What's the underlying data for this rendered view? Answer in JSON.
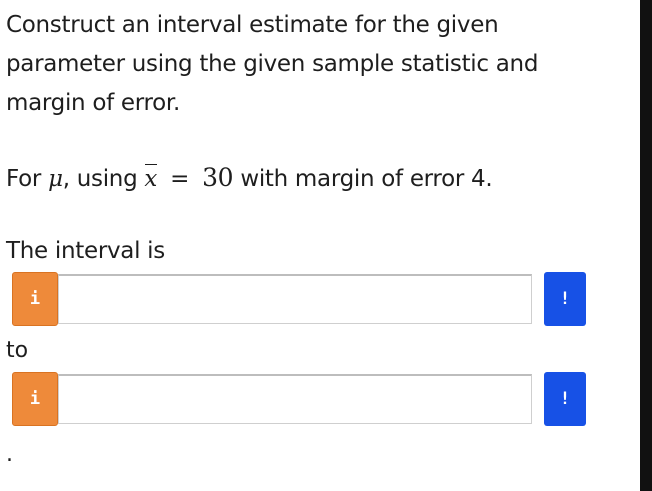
{
  "question": {
    "line1": "Construct an interval estimate for the given",
    "line2": "parameter using the given sample statistic and",
    "line3": "margin of error."
  },
  "given": {
    "prefix": "For",
    "parameter_symbol": "μ",
    "using_text": ", using",
    "statistic_symbol": "x",
    "equals": "=",
    "statistic_value": "30",
    "margin_text": "with margin of error",
    "margin_value": "4",
    "suffix": "."
  },
  "labels": {
    "interval_is": "The interval is",
    "to": "to",
    "period": "."
  },
  "inputs": {
    "lower": {
      "value": "",
      "placeholder": ""
    },
    "upper": {
      "value": "",
      "placeholder": ""
    }
  },
  "buttons": {
    "info_glyph": "i",
    "alert_glyph": "!"
  },
  "colors": {
    "info_button": "#ee8a3a",
    "alert_button": "#1751e6"
  }
}
